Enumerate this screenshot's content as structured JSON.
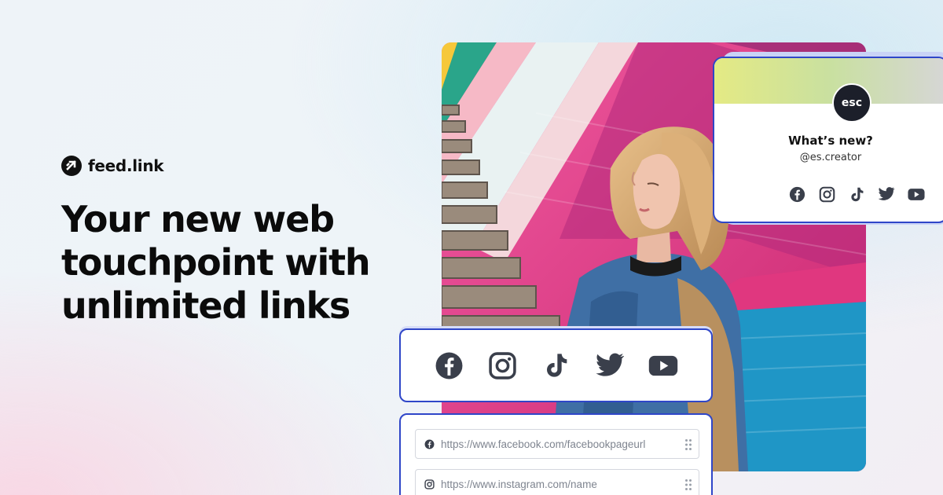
{
  "brand": {
    "name": "feed.link",
    "icon": "arrow-logo-icon"
  },
  "headline": {
    "line1": "Your new web",
    "line2": "touchpoint with",
    "line3_bold": "unlimited",
    "line3_rest": " links"
  },
  "profile_card": {
    "avatar_text": "esc",
    "title": "What’s new?",
    "handle": "@es.creator",
    "social_icons": [
      "facebook-icon",
      "instagram-icon",
      "tiktok-icon",
      "twitter-icon",
      "youtube-icon"
    ]
  },
  "social_bar": {
    "icons": [
      "facebook-icon",
      "instagram-icon",
      "tiktok-icon",
      "twitter-icon",
      "youtube-icon"
    ]
  },
  "link_editor": {
    "rows": [
      {
        "icon": "facebook-icon",
        "value": "https://www.facebook.com/facebookpageurl"
      },
      {
        "icon": "instagram-icon",
        "value": "https://www.instagram.com/name"
      }
    ]
  },
  "colors": {
    "accent_border": "#2f46c8",
    "icon": "#3a3f4b",
    "text_dark": "#0b0b0b",
    "photo_wall_pink": "#e23a8a",
    "photo_wall_blue": "#1f96c6"
  }
}
